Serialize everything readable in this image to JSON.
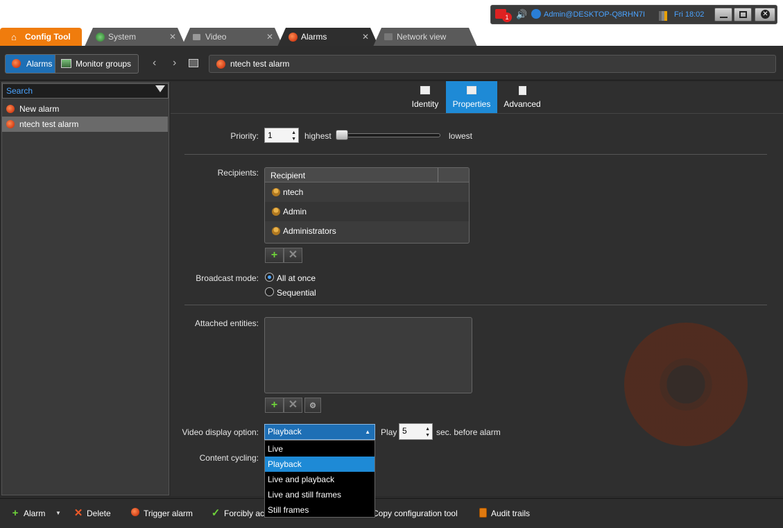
{
  "status_tray": {
    "alarm_count": "1",
    "user_text": "Admin@DESKTOP-Q8RHN7I",
    "time_text": "Fri 18:02"
  },
  "tabs": [
    {
      "label": "Config Tool"
    },
    {
      "label": "System"
    },
    {
      "label": "Video"
    },
    {
      "label": "Alarms"
    },
    {
      "label": "Network view"
    }
  ],
  "toolbar": {
    "alarms_btn": "Alarms",
    "monitor_groups_btn": "Monitor groups",
    "breadcrumb": "ntech test alarm"
  },
  "sidebar": {
    "search_placeholder": "Search",
    "items": [
      {
        "label": "New alarm"
      },
      {
        "label": "ntech test alarm"
      }
    ]
  },
  "view_tabs": [
    {
      "label": "Identity"
    },
    {
      "label": "Properties"
    },
    {
      "label": "Advanced"
    }
  ],
  "properties": {
    "priority_label": "Priority:",
    "priority_value": "1",
    "highest": "highest",
    "lowest": "lowest",
    "priority_slider_fraction": 0.0,
    "recipients_label": "Recipients:",
    "recipient_header": "Recipient",
    "recipients": [
      "ntech",
      "Admin",
      "Administrators"
    ],
    "broadcast_label": "Broadcast mode:",
    "broadcast_options": [
      "All at once",
      "Sequential"
    ],
    "broadcast_selected": "All at once",
    "attached_label": "Attached entities:",
    "video_label": "Video display option:",
    "video_value": "Playback",
    "video_options": [
      "Live",
      "Playback",
      "Live and playback",
      "Live and still frames",
      "Still frames"
    ],
    "play_label": "Play",
    "play_value": "5",
    "sec_label": "sec. before alarm",
    "content_cycling_label": "Content cycling:"
  },
  "bottom_bar": {
    "alarm": "Alarm",
    "delete": "Delete",
    "trigger": "Trigger alarm",
    "forcibly": "Forcibly ac",
    "copy_config": "Copy configuration tool",
    "audit": "Audit trails"
  },
  "colors": {
    "accent": "#1e8ad6",
    "config_tab": "#f07c0d",
    "plus_green": "#6ed23a"
  }
}
